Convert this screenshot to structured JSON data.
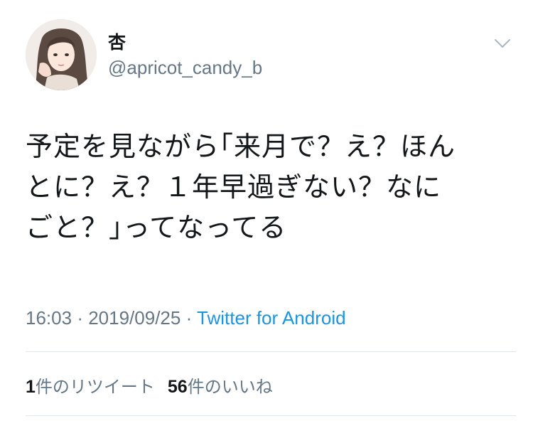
{
  "user": {
    "display_name": "杏",
    "handle": "@apricot_candy_b",
    "avatar_icon": "avatar-illustration"
  },
  "tweet": {
    "text": "予定を見ながら｢来月で？え？ほん\nとに？え？１年早過ぎない？なに\nごと？｣ってなってる",
    "time": "16:03",
    "date": "2019/09/25",
    "separator": "·",
    "source": "Twitter for Android"
  },
  "stats": {
    "retweet_count": "1",
    "retweet_label": "件のリツイート",
    "like_count": "56",
    "like_label": "件のいいね"
  },
  "colors": {
    "text": "#14171a",
    "secondary": "#657786",
    "link": "#1b95e0",
    "divider": "#e1e8ed"
  },
  "icons": {
    "menu": "chevron-down-icon"
  }
}
